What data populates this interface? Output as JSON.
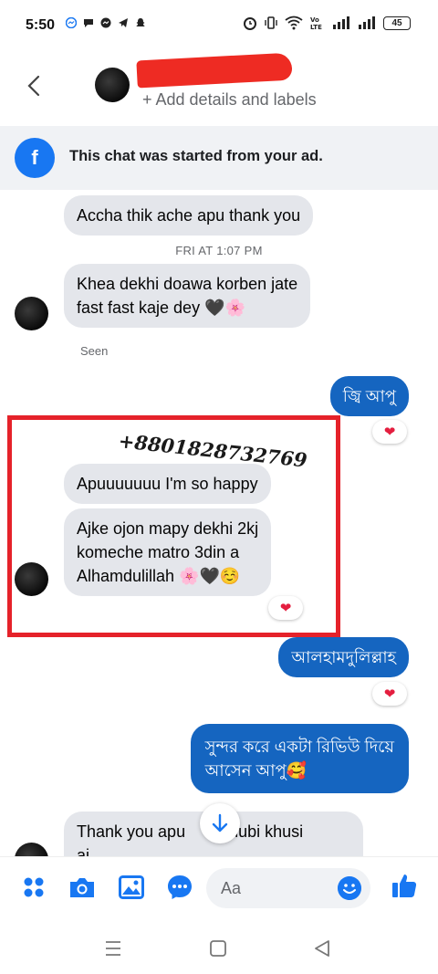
{
  "status_bar": {
    "time": "5:50",
    "battery": "45"
  },
  "header": {
    "add_details": "+ Add details and labels"
  },
  "ad_banner": {
    "text": "This chat was started from your ad."
  },
  "messages": [
    {
      "side": "in",
      "text": "Accha thik ache apu thank you"
    },
    {
      "kind": "timestamp",
      "text": "FRI AT 1:07 PM"
    },
    {
      "side": "in",
      "text_line1": "Khea dekhi doawa korben jate",
      "text_line2": "fast fast kaje dey 🖤🌸"
    },
    {
      "kind": "seen",
      "text": "Seen"
    },
    {
      "side": "out",
      "text": "জ্বি আপু",
      "reaction": "❤"
    },
    {
      "side": "in",
      "text": "Apuuuuuuu I'm so happy"
    },
    {
      "side": "in",
      "text_line1": "Ajke ojon mapy dekhi 2kj",
      "text_line2": "komeche matro 3din a",
      "text_line3": "Alhamdulillah 🌸🖤☺️",
      "reaction": "❤"
    },
    {
      "side": "out",
      "text": "আলহামদুলিল্লাহ",
      "reaction": "❤"
    },
    {
      "side": "out",
      "text_line1": "সুন্দর করে একটা রিভিউ দিয়ে",
      "text_line2": "আসেন আপু🥰"
    },
    {
      "side": "in",
      "text_line1": "Thank you apu",
      "text_line1b": "khubi khusi",
      "text_line2": "ai"
    }
  ],
  "overlay": {
    "phone": "+8801828732769"
  },
  "input_bar": {
    "placeholder": "Aa"
  },
  "colors": {
    "brand_blue": "#1877f2",
    "outgoing_bubble": "#1565c0",
    "incoming_bubble": "#e4e6eb",
    "highlight_box": "#e5222a"
  }
}
